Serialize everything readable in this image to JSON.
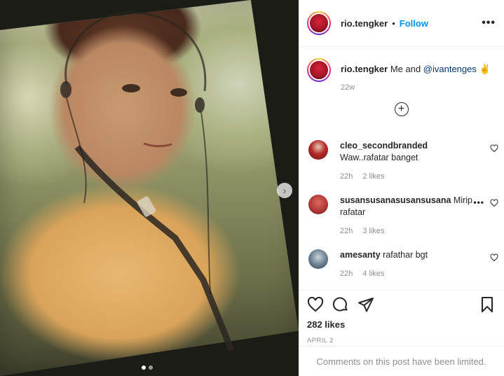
{
  "post": {
    "username": "rio.tengker",
    "separator": "•",
    "follow_label": "Follow",
    "more_label": "•••"
  },
  "caption": {
    "username": "rio.tengker",
    "text_before": "Me and ",
    "mention": "@ivantenges",
    "emoji": "✌",
    "age": "22w"
  },
  "load_more_label": "+",
  "comments": [
    {
      "username": "cleo_secondbranded",
      "text": "Waw..rafatar banget",
      "age": "22h",
      "likes": "2 likes",
      "avatar_color": "#b52a2a"
    },
    {
      "username": "susansusanasusansusana",
      "text": "Mirip rafatar",
      "age": "22h",
      "likes": "3 likes",
      "avatar_color": "#b43838",
      "more_label": "•••"
    },
    {
      "username": "amesanty",
      "text": "rafathar bgt",
      "age": "22h",
      "likes": "4 likes",
      "avatar_color": "#4d6272"
    }
  ],
  "likes": "282 likes",
  "date": "APRIL 2",
  "limited_notice": "Comments on this post have been limited.",
  "carousel": {
    "next_label": "›",
    "slides": 2,
    "active_slide": 1
  },
  "icons": {
    "like": "heart-icon",
    "comment": "comment-icon",
    "share": "share-icon",
    "save": "bookmark-icon",
    "load_more": "plus-circle-icon",
    "next": "chevron-right-icon",
    "comment_like": "heart-icon"
  },
  "colors": {
    "follow": "#0095f6",
    "meta": "#8e8e8e",
    "mention": "#00376b"
  }
}
